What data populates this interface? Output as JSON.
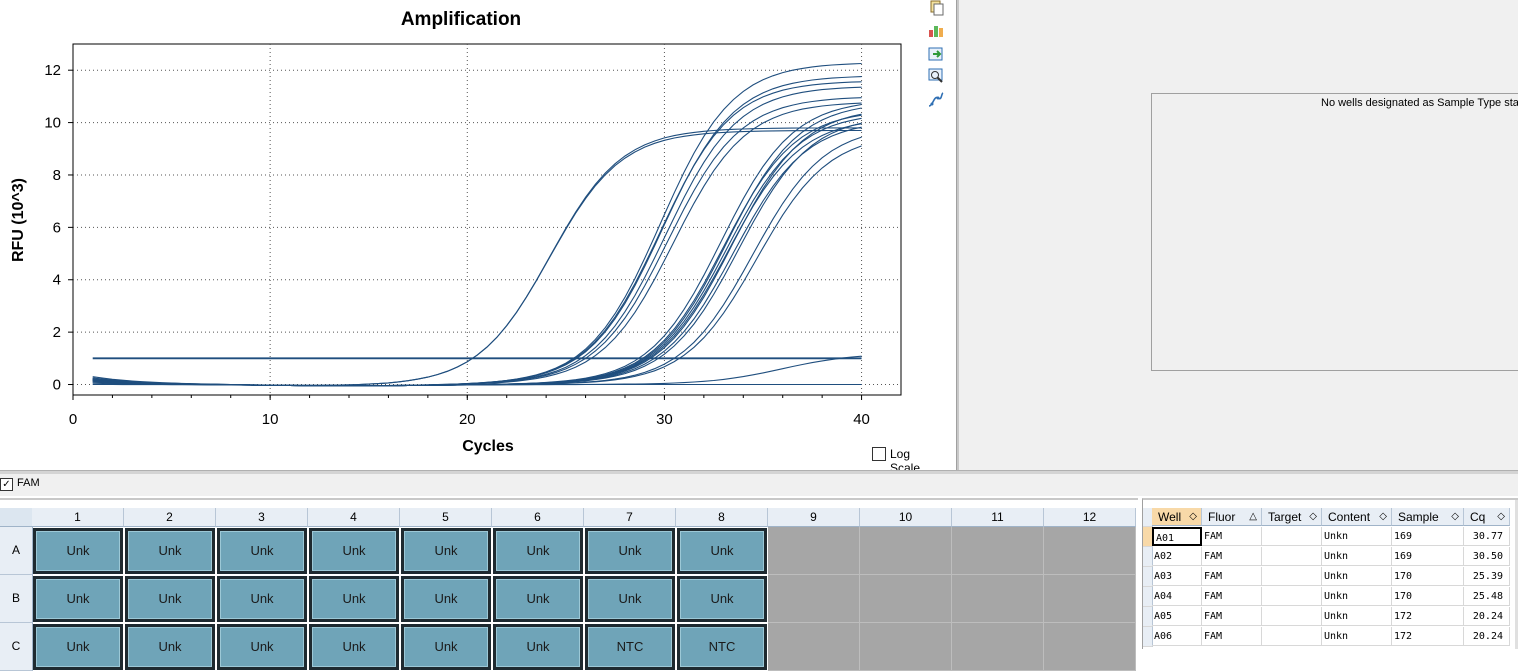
{
  "chart_data": {
    "type": "line",
    "title": "Amplification",
    "xlabel": "Cycles",
    "ylabel": "RFU (10^3)",
    "xlim": [
      0,
      42
    ],
    "ylim": [
      -0.4,
      13
    ],
    "xticks": [
      0,
      10,
      20,
      30,
      40
    ],
    "yticks": [
      0,
      2,
      4,
      6,
      8,
      10,
      12
    ],
    "grid": true,
    "threshold": 1.0,
    "line_color": "#1f4e7e",
    "x_start": 1,
    "x_end": 40,
    "series": [
      {
        "cq": 20.24,
        "plateau": 9.8,
        "baseline": 0.3
      },
      {
        "cq": 20.24,
        "plateau": 9.7,
        "baseline": 0.25
      },
      {
        "cq": 25.39,
        "plateau": 12.3,
        "baseline": 0.2
      },
      {
        "cq": 25.48,
        "plateau": 11.6,
        "baseline": 0.2
      },
      {
        "cq": 25.55,
        "plateau": 11.8,
        "baseline": 0.15
      },
      {
        "cq": 25.8,
        "plateau": 11.4,
        "baseline": 0.2
      },
      {
        "cq": 26.0,
        "plateau": 11.0,
        "baseline": 0.1
      },
      {
        "cq": 26.3,
        "plateau": 10.8,
        "baseline": 0.15
      },
      {
        "cq": 28.7,
        "plateau": 10.9,
        "baseline": 0.2
      },
      {
        "cq": 28.9,
        "plateau": 10.5,
        "baseline": 0.15
      },
      {
        "cq": 29.0,
        "plateau": 10.8,
        "baseline": 0.2
      },
      {
        "cq": 29.1,
        "plateau": 10.4,
        "baseline": 0.1
      },
      {
        "cq": 29.2,
        "plateau": 10.2,
        "baseline": 0.15
      },
      {
        "cq": 29.3,
        "plateau": 10.6,
        "baseline": 0.2
      },
      {
        "cq": 29.5,
        "plateau": 10.1,
        "baseline": 0.1
      },
      {
        "cq": 29.7,
        "plateau": 10.3,
        "baseline": 0.15
      },
      {
        "cq": 30.5,
        "plateau": 9.9,
        "baseline": 0.2
      },
      {
        "cq": 30.77,
        "plateau": 9.6,
        "baseline": 0.25
      },
      {
        "cq": 38.9,
        "plateau": 1.2,
        "baseline": 0.0
      },
      {
        "cq": null,
        "plateau": 0.0,
        "baseline": 0.05
      }
    ]
  },
  "log_scale": {
    "label": "Log Scale",
    "checked": false
  },
  "toolbar": {
    "icons": [
      "copy-icon",
      "chart-settings-icon",
      "export-icon",
      "zoom-icon",
      "curve-icon"
    ]
  },
  "sample_panel": {
    "message": "No wells designated as Sample Type stan"
  },
  "fluor_filter": {
    "label": "FAM",
    "checked": true
  },
  "plate": {
    "columns": [
      "1",
      "2",
      "3",
      "4",
      "5",
      "6",
      "7",
      "8",
      "9",
      "10",
      "11",
      "12"
    ],
    "rows": [
      {
        "label": "A",
        "wells": [
          "Unk",
          "Unk",
          "Unk",
          "Unk",
          "Unk",
          "Unk",
          "Unk",
          "Unk",
          "",
          "",
          "",
          ""
        ]
      },
      {
        "label": "B",
        "wells": [
          "Unk",
          "Unk",
          "Unk",
          "Unk",
          "Unk",
          "Unk",
          "Unk",
          "Unk",
          "",
          "",
          "",
          ""
        ]
      },
      {
        "label": "C",
        "wells": [
          "Unk",
          "Unk",
          "Unk",
          "Unk",
          "Unk",
          "Unk",
          "NTC",
          "NTC",
          "",
          "",
          "",
          ""
        ]
      }
    ],
    "colors": {
      "filled": "#6fa4b8",
      "empty": "#a6a6a6"
    }
  },
  "results_table": {
    "headers": [
      "Well",
      "Fluor",
      "Target",
      "Content",
      "Sample",
      "Cq"
    ],
    "rows": [
      {
        "well": "A01",
        "fluor": "FAM",
        "target": "",
        "content": "Unkn",
        "sample": "169",
        "cq": "30.77"
      },
      {
        "well": "A02",
        "fluor": "FAM",
        "target": "",
        "content": "Unkn",
        "sample": "169",
        "cq": "30.50"
      },
      {
        "well": "A03",
        "fluor": "FAM",
        "target": "",
        "content": "Unkn",
        "sample": "170",
        "cq": "25.39"
      },
      {
        "well": "A04",
        "fluor": "FAM",
        "target": "",
        "content": "Unkn",
        "sample": "170",
        "cq": "25.48"
      },
      {
        "well": "A05",
        "fluor": "FAM",
        "target": "",
        "content": "Unkn",
        "sample": "172",
        "cq": "20.24"
      },
      {
        "well": "A06",
        "fluor": "FAM",
        "target": "",
        "content": "Unkn",
        "sample": "172",
        "cq": "20.24"
      }
    ]
  }
}
